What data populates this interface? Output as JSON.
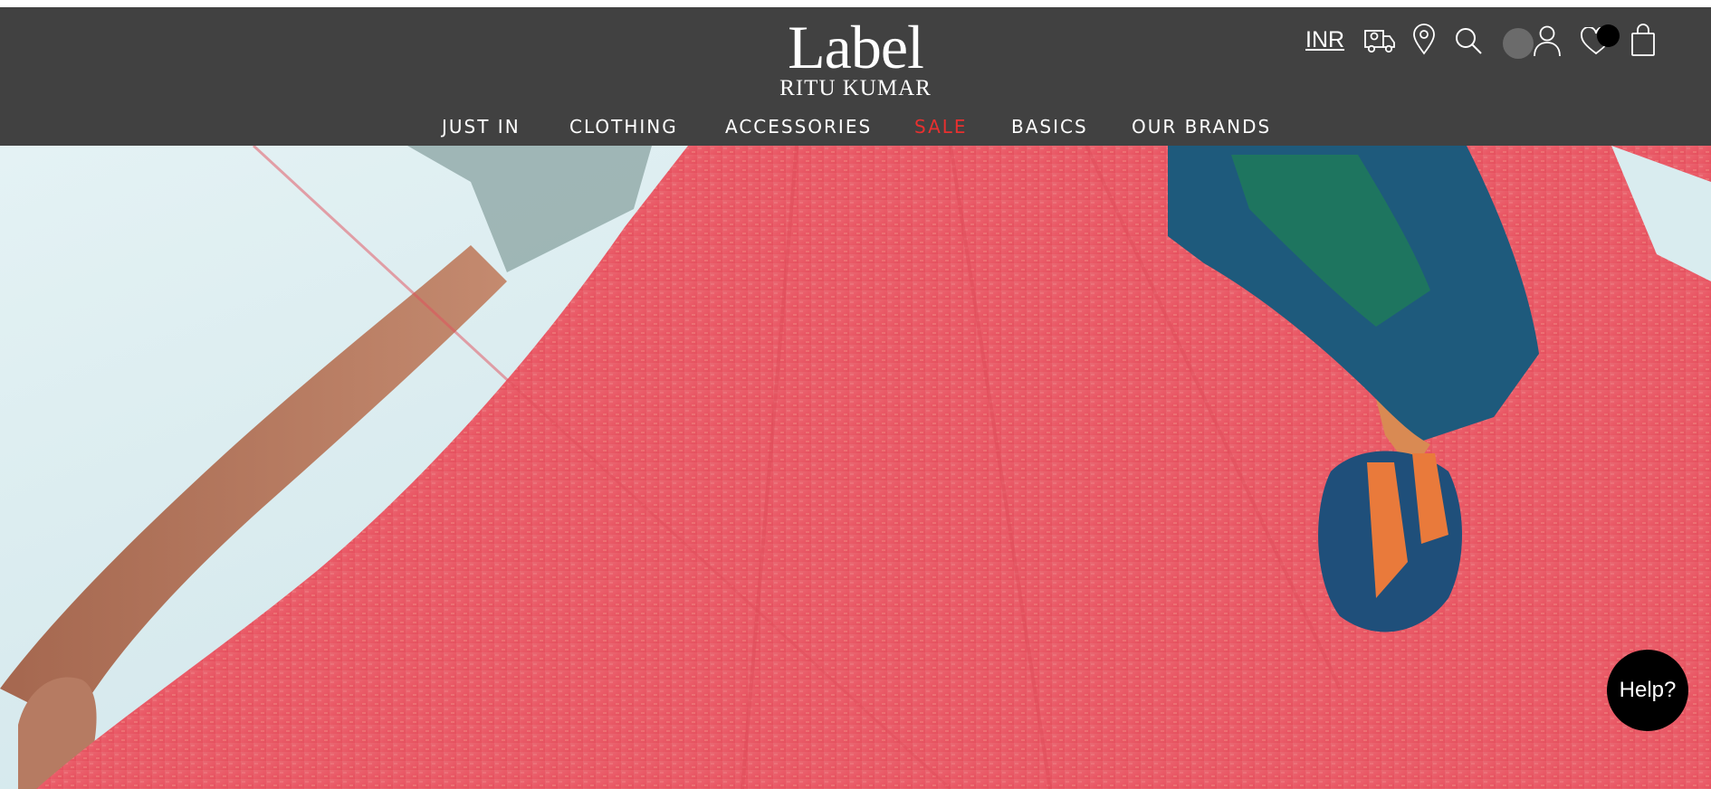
{
  "brand": {
    "name": "Label",
    "subname": "RITU KUMAR"
  },
  "header": {
    "currency": "INR",
    "icons": [
      "truck-icon",
      "location-pin-icon",
      "search-icon",
      "user-icon",
      "heart-icon",
      "shopping-bag-icon"
    ]
  },
  "nav": {
    "items": [
      {
        "label": "JUST IN"
      },
      {
        "label": "CLOTHING"
      },
      {
        "label": "ACCESSORIES"
      },
      {
        "label": "SALE",
        "highlight": true
      },
      {
        "label": "BASICS"
      },
      {
        "label": "OUR BRANDS"
      }
    ]
  },
  "help": {
    "label": "Help?"
  },
  "colors": {
    "header_bg": "#414141",
    "sale": "#e8302f",
    "fabric": "#ea5a67",
    "scarf": "#1e5a7c",
    "tassel": "#e97a3b"
  }
}
